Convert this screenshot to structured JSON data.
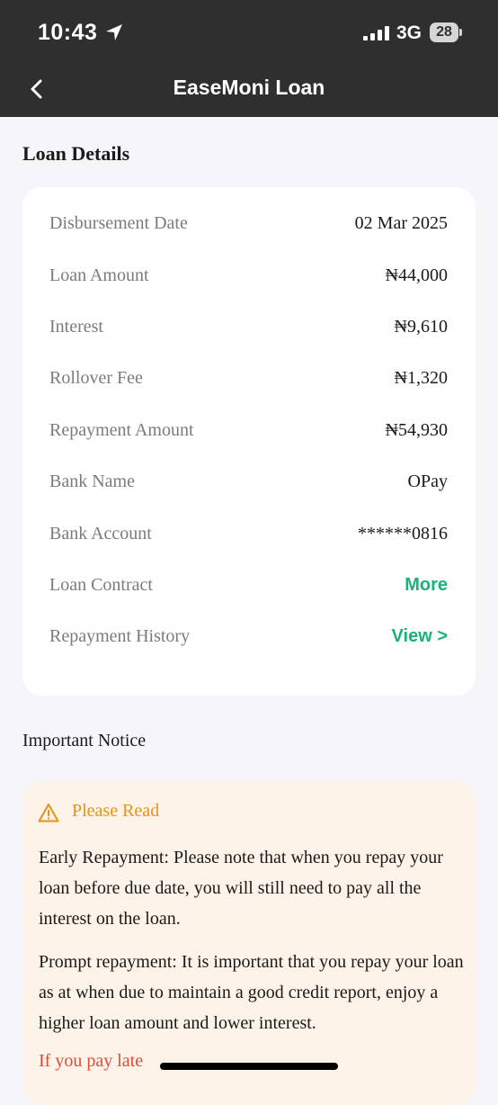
{
  "status_bar": {
    "time": "10:43",
    "network": "3G",
    "battery": "28"
  },
  "header": {
    "title": "EaseMoni Loan"
  },
  "loan_details": {
    "title": "Loan Details",
    "rows": [
      {
        "label": "Disbursement Date",
        "value": "02 Mar 2025"
      },
      {
        "label": "Loan Amount",
        "value": "₦44,000"
      },
      {
        "label": "Interest",
        "value": "₦9,610"
      },
      {
        "label": "Rollover Fee",
        "value": "₦1,320"
      },
      {
        "label": "Repayment Amount",
        "value": "₦54,930"
      },
      {
        "label": "Bank Name",
        "value": "OPay"
      },
      {
        "label": "Bank Account",
        "value": "******0816"
      },
      {
        "label": "Loan Contract",
        "value": "More"
      },
      {
        "label": "Repayment History",
        "value": "View >"
      }
    ]
  },
  "notice": {
    "heading": "Important Notice",
    "title": "Please Read",
    "paragraphs": [
      "Early Repayment: Please note that when you repay your loan before due date, you will still need to pay all the interest on the loan.",
      "Prompt repayment: It is important that you repay your loan as at when due to maintain a good credit report, enjoy a higher loan amount and lower interest."
    ],
    "late": "If you pay late"
  },
  "colors": {
    "header_bg": "#2f2f2f",
    "page_bg": "#f6f5fa",
    "link_green": "#19b27b",
    "warning_orange": "#e8930f",
    "alert_red": "#e04a3a",
    "notice_bg": "#fdf3e8"
  }
}
